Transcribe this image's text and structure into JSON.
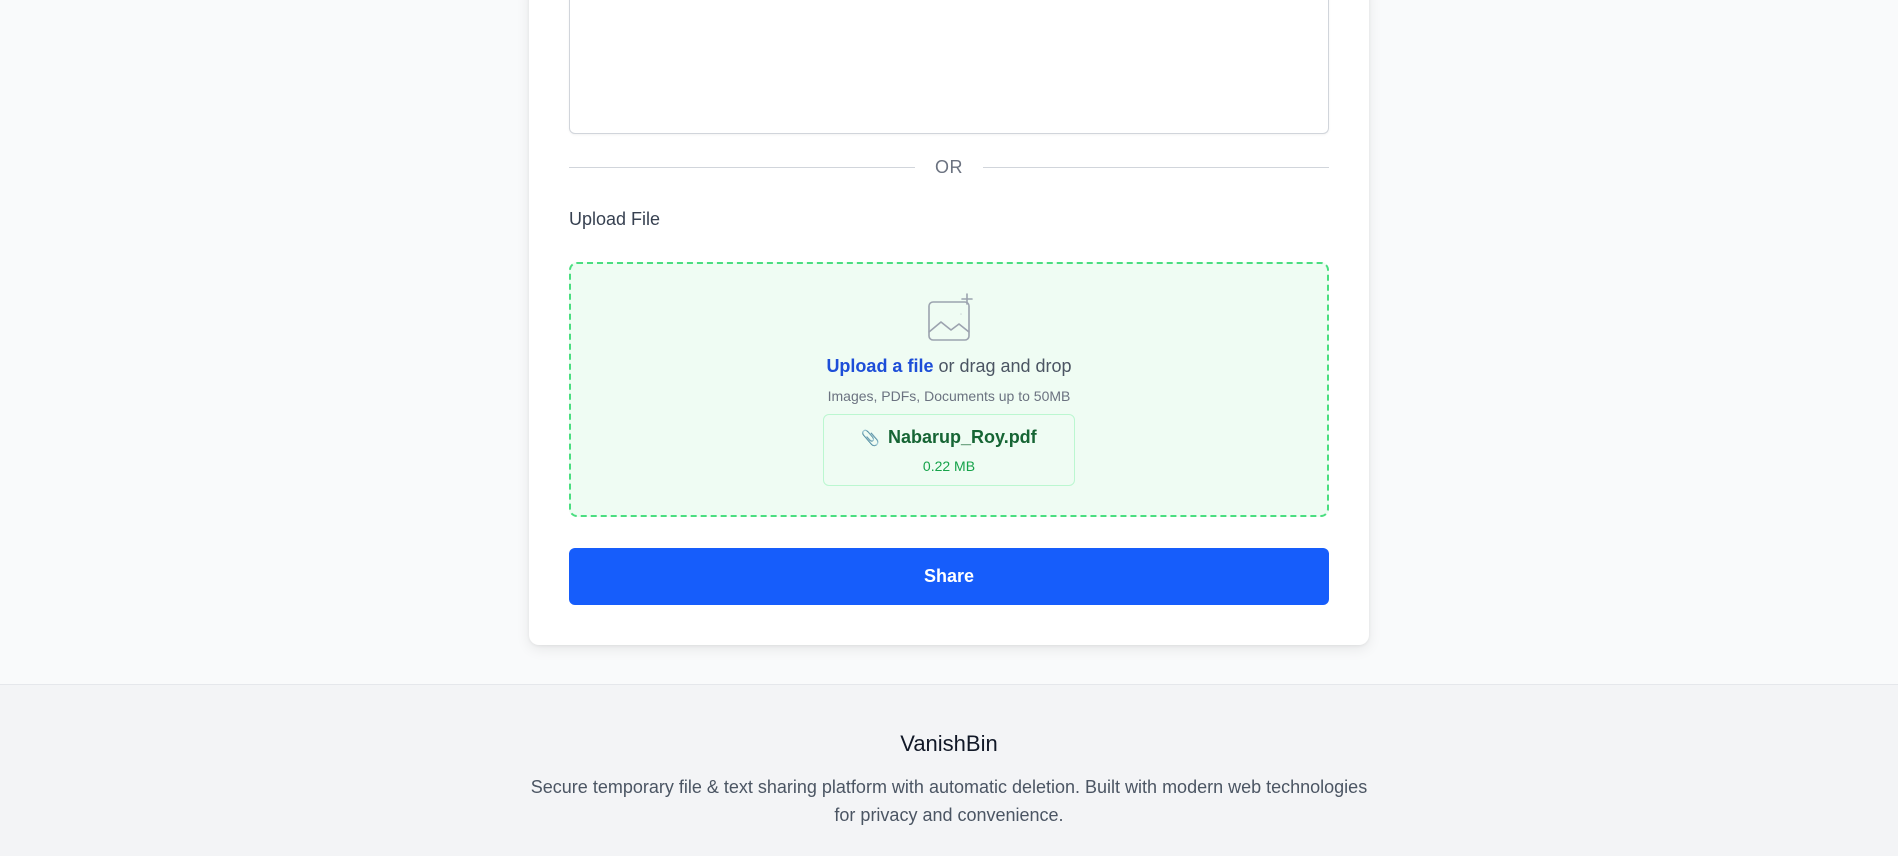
{
  "form": {
    "text_value": "",
    "divider_text": "OR",
    "upload_label": "Upload File"
  },
  "dropzone": {
    "upload_link": "Upload a file",
    "drag_text": " or drag and drop",
    "hint": "Images, PDFs, Documents up to 50MB",
    "icon": "image-plus-icon",
    "file": {
      "icon": "paperclip-icon",
      "clip_glyph": "📎",
      "name": "Nabarup_Roy.pdf",
      "size": "0.22 MB"
    }
  },
  "actions": {
    "share_label": "Share"
  },
  "footer": {
    "brand": "VanishBin",
    "description": "Secure temporary file & text sharing platform with automatic deletion. Built with modern web technologies for privacy and convenience."
  },
  "colors": {
    "primary": "#165dfb",
    "dropzone_border": "#4ade80",
    "dropzone_bg": "#effcf3",
    "file_name": "#166534",
    "file_size": "#16a34a",
    "link": "#1d4ed8"
  }
}
